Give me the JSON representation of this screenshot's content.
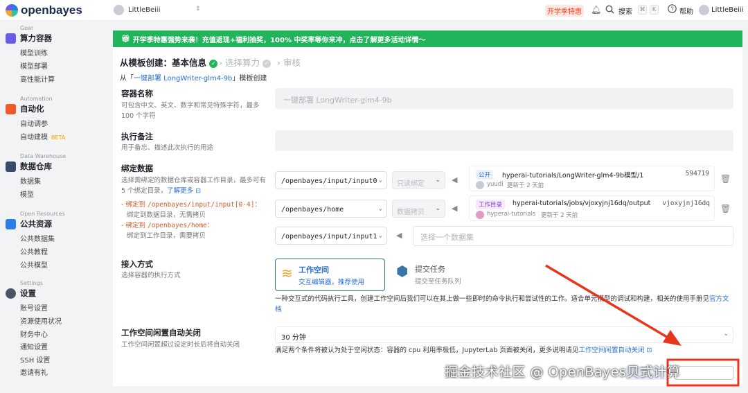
{
  "brand": {
    "name": "openbayes"
  },
  "topbar": {
    "workspace": "LittleBeiii",
    "promo": "开学季特惠",
    "search_label": "搜索",
    "kbd_meta": "⌘",
    "kbd_key": "K",
    "help_label": "帮助",
    "user_name": "LittleBeiii"
  },
  "sidebar": {
    "groups": [
      {
        "eng": "Gear",
        "title": "算力容器",
        "color": "#6b5ce7",
        "items": [
          "模型训练",
          "模型部署",
          "高性能计算"
        ]
      },
      {
        "eng": "Automation",
        "title": "自动化",
        "color": "#f05a28",
        "items": [
          "自动调参",
          "自动建模"
        ],
        "beta": "BETA"
      },
      {
        "eng": "Data Warehouse",
        "title": "数据仓库",
        "color": "#3a4a6b",
        "items": [
          "数据集",
          "模型"
        ]
      },
      {
        "eng": "Open Resources",
        "title": "公共资源",
        "color": "#2a7de1",
        "items": [
          "公共数据集",
          "公共教程",
          "公共模型"
        ]
      },
      {
        "eng": "Settings",
        "title": "设置",
        "color": "#4a5568",
        "items": [
          "账号设置",
          "资源使用状况",
          "财务中心",
          "通知设置",
          "SSH 设置",
          "邀请有礼"
        ]
      }
    ]
  },
  "banner": {
    "text": "开学季特惠强势来袭！充值返现+福利抽奖，100% 中奖率等你来冲，点击了解更多活动详情～"
  },
  "steps": {
    "active": "从模板创建：基本信息",
    "s2": "选择算力",
    "s3": "审核"
  },
  "subhead": {
    "prefix": "从「",
    "link": "一键部署 LongWriter-glm4-9b",
    "suffix": "」模板创建"
  },
  "form": {
    "name": {
      "title": "容器名称",
      "desc1": "可包含中文、英文、数字和常见特殊字符，最多",
      "desc2": "100 个字符",
      "placeholder": "一键部署 LongWriter-glm4-9b"
    },
    "note": {
      "title": "执行备注",
      "desc": "用于备忘、描述此次执行的用途"
    },
    "bind": {
      "title": "绑定数据",
      "desc1": "选择需绑定的数据仓库或容器工作目录，最多可有",
      "desc2": "5 个绑定目录，",
      "learn_more": "了解更多",
      "rule1a": "- 绑定到",
      "rule1b": "/openbayes/input/input[0-4]",
      "rule1c": "：",
      "rule1d": "绑定到数据目录，无需拷贝",
      "rule2a": "- 绑定到",
      "rule2b": "/openbayes/home",
      "rule2c": "：",
      "rule2d": "绑定到工作目录，需要拷贝",
      "rows": [
        {
          "path": "/openbayes/input/input0",
          "mode": "只读绑定",
          "tag": "公开",
          "title": "hyperai-tutorials/LongWriter-glm4-9b模型/1",
          "id": "594719",
          "owner": "yuudi",
          "updated": "更新于 2 天前"
        },
        {
          "path": "/openbayes/home",
          "mode": "数据拷贝",
          "tag": "工作目录",
          "title": "hyperai-tutorials/jobs/vjoxyjnj16dq/output",
          "id": "vjoxyjnj16dq",
          "owner": "hyperai-tutorials",
          "updated": "更新于 2 天前"
        },
        {
          "path": "/openbayes/input/input1",
          "placeholder": "选择一个数据集"
        }
      ]
    },
    "access": {
      "title": "接入方式",
      "desc": "选择容器的执行方式",
      "opt1_title": "工作空间",
      "opt1_desc": "交互编辑器，推荐使用",
      "opt2_title": "提交任务",
      "opt2_desc": "提交至任务队列",
      "note1": "一种交互式的代码执行工具，创建工作空间后我们可以在其上做一些即时的命令执行和尝试性的工作。适合单元模型的调试和构建，相关的使用手册见",
      "note_link1": "官方",
      "note_link2": "文档"
    },
    "idle": {
      "title": "工作空间闲置自动关闭",
      "desc": "工作空间闲置超过设定时长后将自动关闭",
      "value": "30 分钟",
      "note": "满足两个条件将被认为处于空闲状态：容器的 cpu 利用率极低，JupyterLab 页面被关闭，更多说明请见",
      "note_link": "工作空间闲置自动关闭"
    }
  },
  "footer": {
    "watermark": "掘金技术社区 @ OpenBayes贝式计算"
  },
  "colors": {
    "accent": "#2a6fd4",
    "banner": "#22b45b",
    "annotation": "#e8361e"
  }
}
